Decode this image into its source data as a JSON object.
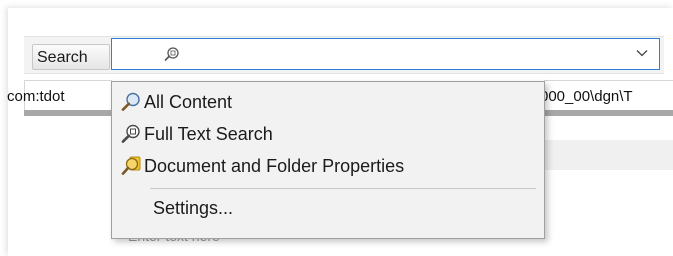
{
  "toolbar": {
    "search_label": "Search"
  },
  "path": {
    "left_fragment": "com:tdot",
    "right_fragment": "000_00\\dgn\\T"
  },
  "background_hint": "Enter text here",
  "menu": {
    "items": [
      {
        "label": "All Content",
        "icon": "magnifier-icon"
      },
      {
        "label": "Full Text Search",
        "icon": "fulltext-search-icon"
      },
      {
        "label": "Document and Folder Properties",
        "icon": "properties-search-icon"
      }
    ],
    "settings_label": "Settings..."
  },
  "colors": {
    "focus_border": "#2f7fd6",
    "menu_background": "#f2f2f2"
  }
}
